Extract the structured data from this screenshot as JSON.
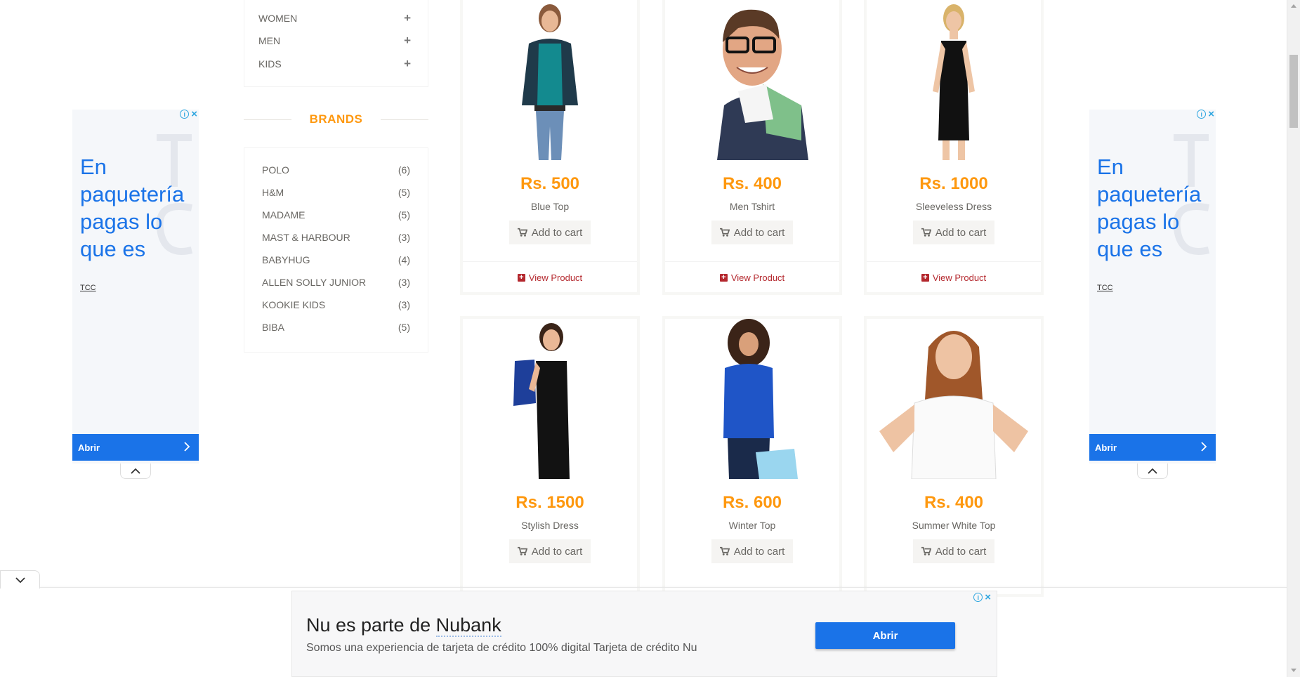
{
  "category": {
    "items": [
      {
        "label": "WOMEN"
      },
      {
        "label": "MEN"
      },
      {
        "label": "KIDS"
      }
    ]
  },
  "brands": {
    "title": "BRANDS",
    "items": [
      {
        "name": "POLO",
        "count": "(6)"
      },
      {
        "name": "H&M",
        "count": "(5)"
      },
      {
        "name": "MADAME",
        "count": "(5)"
      },
      {
        "name": "MAST & HARBOUR",
        "count": "(3)"
      },
      {
        "name": "BABYHUG",
        "count": "(4)"
      },
      {
        "name": "ALLEN SOLLY JUNIOR",
        "count": "(3)"
      },
      {
        "name": "KOOKIE KIDS",
        "count": "(3)"
      },
      {
        "name": "BIBA",
        "count": "(5)"
      }
    ]
  },
  "products": [
    {
      "price": "Rs. 500",
      "name": "Blue Top",
      "cart": "Add to cart",
      "view": "View Product"
    },
    {
      "price": "Rs. 400",
      "name": "Men Tshirt",
      "cart": "Add to cart",
      "view": "View Product"
    },
    {
      "price": "Rs. 1000",
      "name": "Sleeveless Dress",
      "cart": "Add to cart",
      "view": "View Product"
    },
    {
      "price": "Rs. 1500",
      "name": "Stylish Dress",
      "cart": "Add to cart"
    },
    {
      "price": "Rs. 600",
      "name": "Winter Top",
      "cart": "Add to cart"
    },
    {
      "price": "Rs. 400",
      "name": "Summer White Top",
      "cart": "Add to cart"
    }
  ],
  "side_ad": {
    "headline": "En paquetería pagas lo que es",
    "brand": "TCC",
    "button": "Abrir"
  },
  "bottom_ad": {
    "title_prefix": "Nu es parte de ",
    "title_link": "Nubank",
    "description": "Somos una experiencia de tarjeta de crédito 100% digital Tarjeta de crédito Nu",
    "button": "Abrir"
  },
  "colors": {
    "price": "#fe980f",
    "view_link": "#b4282e",
    "ad_blue": "#1a73e8"
  }
}
